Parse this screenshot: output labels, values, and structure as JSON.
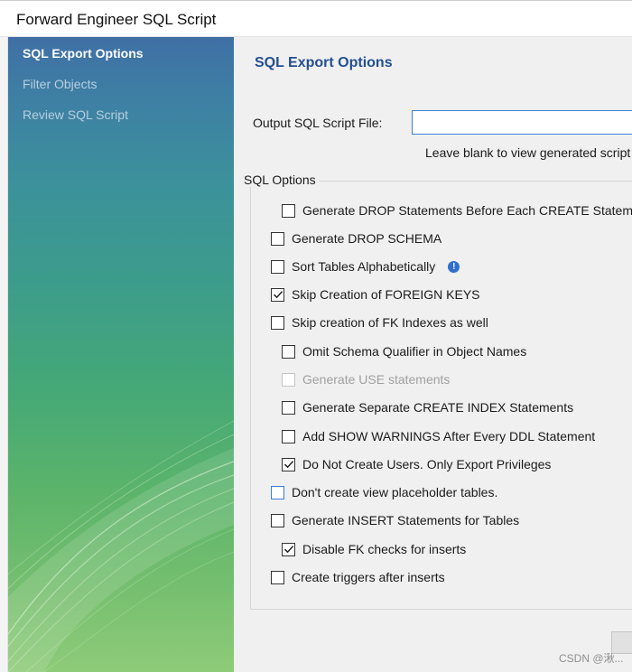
{
  "window": {
    "title": "Forward Engineer SQL Script"
  },
  "sidebar": {
    "items": [
      {
        "label": "SQL Export Options",
        "active": true
      },
      {
        "label": "Filter Objects",
        "active": false
      },
      {
        "label": "Review SQL Script",
        "active": false
      }
    ]
  },
  "main": {
    "heading": "SQL Export Options",
    "output_label": "Output SQL Script File:",
    "output_value": "",
    "hint": "Leave blank to view generated script b",
    "group_label": "SQL Options",
    "options": [
      {
        "label": "Generate DROP Statements Before Each CREATE Statement",
        "checked": false,
        "enabled": true
      },
      {
        "label": "Generate DROP SCHEMA",
        "checked": false,
        "enabled": true
      },
      {
        "label": "Sort Tables Alphabetically",
        "checked": false,
        "enabled": true,
        "info_icon": true
      },
      {
        "label": "Skip Creation of FOREIGN KEYS",
        "checked": true,
        "enabled": true
      },
      {
        "label": "Skip creation of FK Indexes as well",
        "checked": false,
        "enabled": true
      },
      {
        "label": "Omit Schema Qualifier in Object Names",
        "checked": false,
        "enabled": true
      },
      {
        "label": "Generate USE statements",
        "checked": false,
        "enabled": false
      },
      {
        "label": "Generate Separate CREATE INDEX Statements",
        "checked": false,
        "enabled": true
      },
      {
        "label": "Add SHOW WARNINGS After Every DDL Statement",
        "checked": false,
        "enabled": true
      },
      {
        "label": "Do Not Create Users. Only Export Privileges",
        "checked": true,
        "enabled": true
      },
      {
        "label": "Don't create view placeholder tables.",
        "checked": false,
        "enabled": true,
        "focused": true
      },
      {
        "label": "Generate INSERT Statements for Tables",
        "checked": false,
        "enabled": true
      },
      {
        "label": "Disable FK checks for inserts",
        "checked": true,
        "enabled": true
      },
      {
        "label": "Create triggers after inserts",
        "checked": false,
        "enabled": true
      }
    ]
  },
  "icons": {
    "check": "check-icon",
    "info": "info-icon",
    "info_glyph": "!"
  },
  "colors": {
    "accent": "#234f91",
    "focus": "#3b7fd6",
    "info": "#2f6fd0"
  },
  "watermark": "CSDN @湫..."
}
